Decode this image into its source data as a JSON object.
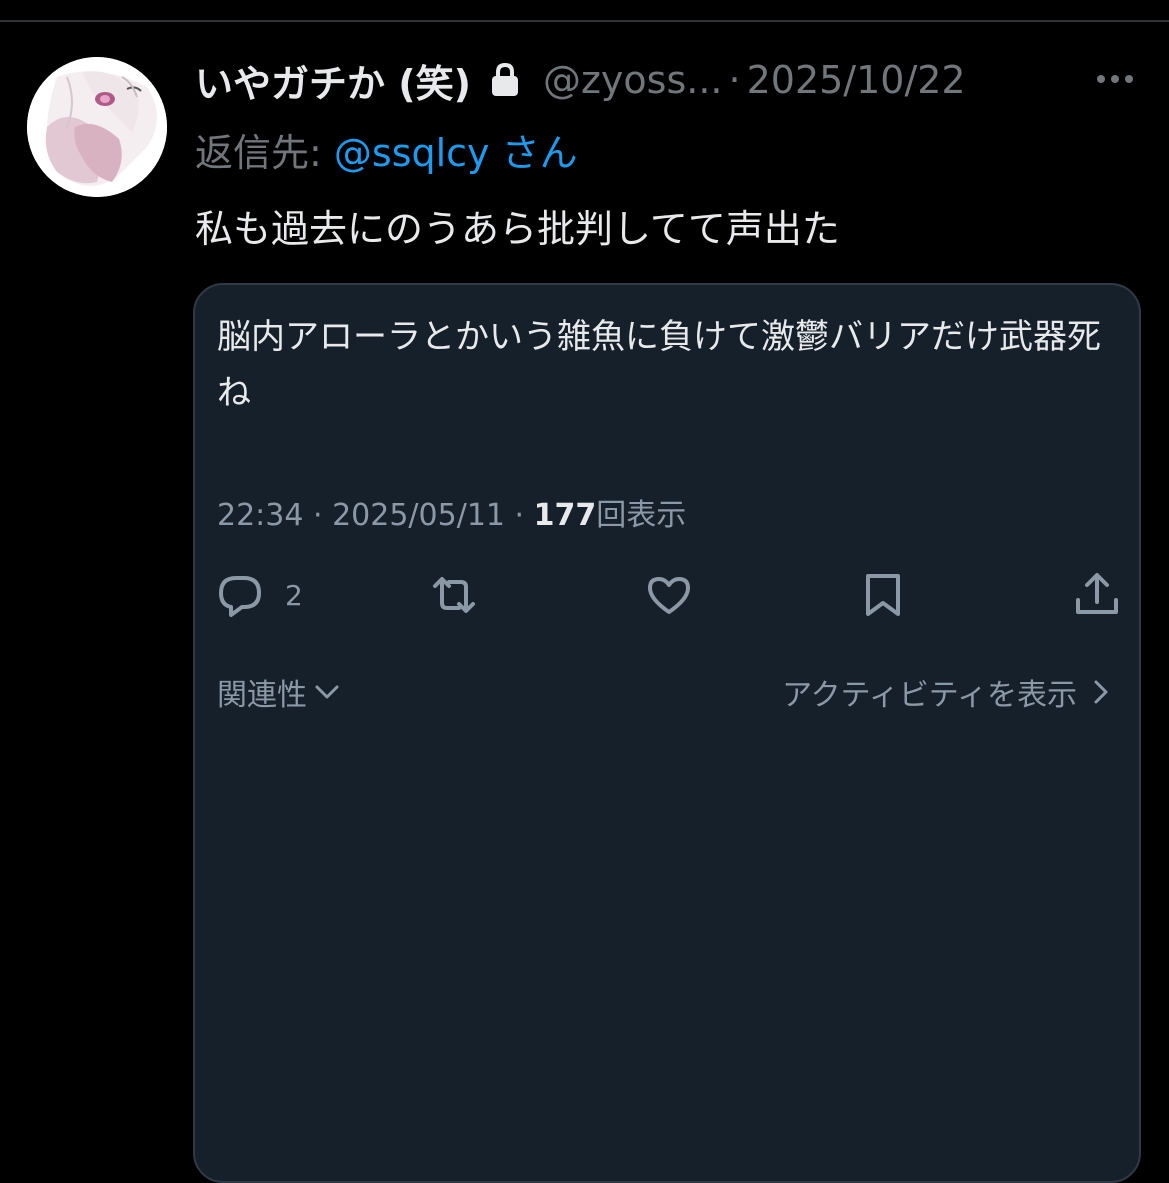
{
  "post": {
    "display_name": "いやガチか (笑)",
    "handle": "@zyoss...",
    "separator": "·",
    "date": "2025/10/22",
    "reply_prefix": "返信先: ",
    "reply_mention": "@ssqlcy",
    "reply_suffix": " さん",
    "text": "私も過去にのうあら批判してて声出た"
  },
  "quote": {
    "text": "脳内アローラとかいう雑魚に負けて激鬱バリアだけ武器死ね",
    "time": "22:34",
    "meta_sep": " · ",
    "date": "2025/05/11",
    "views_count": "177",
    "views_label": "回表示",
    "reply_count": "2",
    "sort_label": "関連性",
    "activity_label": "アクティビティを表示"
  },
  "icons": {
    "lock": "lock-icon",
    "more": "more-icon",
    "reply": "reply-icon",
    "retweet": "retweet-icon",
    "like": "heart-icon",
    "bookmark": "bookmark-icon",
    "share": "share-icon",
    "sort_chevron": "chevron-down-icon",
    "activity_chevron": "chevron-right-icon"
  },
  "colors": {
    "background": "#000000",
    "card": "#16202a",
    "mention": "#1d9bf0",
    "secondary_text": "#71767b",
    "primary_text": "#e7e9ea"
  }
}
